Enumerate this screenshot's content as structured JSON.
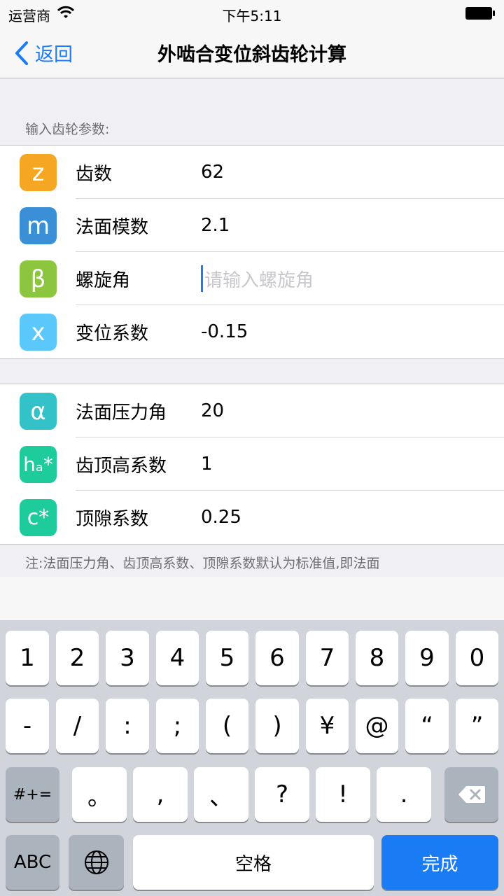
{
  "status_bar": {
    "carrier": "运营商",
    "time": "下午5:11",
    "wifi_icon": "wifi-icon",
    "battery_icon": "battery-icon"
  },
  "nav": {
    "back_label": "返回",
    "title": "外啮合变位斜齿轮计算"
  },
  "section_header": "输入齿轮参数:",
  "group1": [
    {
      "icon_text": "z",
      "icon_color": "#f5a623",
      "label": "齿数",
      "value": "62",
      "placeholder": ""
    },
    {
      "icon_text": "m",
      "icon_color": "#3a8fd6",
      "label": "法面模数",
      "value": "2.1",
      "placeholder": ""
    },
    {
      "icon_text": "β",
      "icon_color": "#8cc63f",
      "label": "螺旋角",
      "value": "",
      "placeholder": "请输入螺旋角"
    },
    {
      "icon_text": "x",
      "icon_color": "#5ac8fa",
      "label": "变位系数",
      "value": "-0.15",
      "placeholder": ""
    }
  ],
  "group2": [
    {
      "icon_text": "α",
      "icon_color": "#34c2c9",
      "label": "法面压力角",
      "value": "20"
    },
    {
      "icon_text": "hₐ*",
      "icon_color": "#1ecb9a",
      "label": "齿顶高系数",
      "value": "1"
    },
    {
      "icon_text": "c*",
      "icon_color": "#1ecb9a",
      "label": "顶隙系数",
      "value": "0.25"
    }
  ],
  "note": "注:法面压力角、齿顶高系数、顶隙系数默认为标准值,即法面",
  "keyboard": {
    "row1": [
      "1",
      "2",
      "3",
      "4",
      "5",
      "6",
      "7",
      "8",
      "9",
      "0"
    ],
    "row2": [
      "-",
      "/",
      ":",
      ";",
      "(",
      ")",
      "¥",
      "@",
      "“",
      "”"
    ],
    "row3_left": "#+=",
    "row3": [
      "。",
      ",",
      "、",
      "?",
      "!",
      "."
    ],
    "row4_left": "ABC",
    "space": "空格",
    "done": "完成",
    "globe_icon": "globe-icon",
    "delete_icon": "backspace-icon"
  }
}
